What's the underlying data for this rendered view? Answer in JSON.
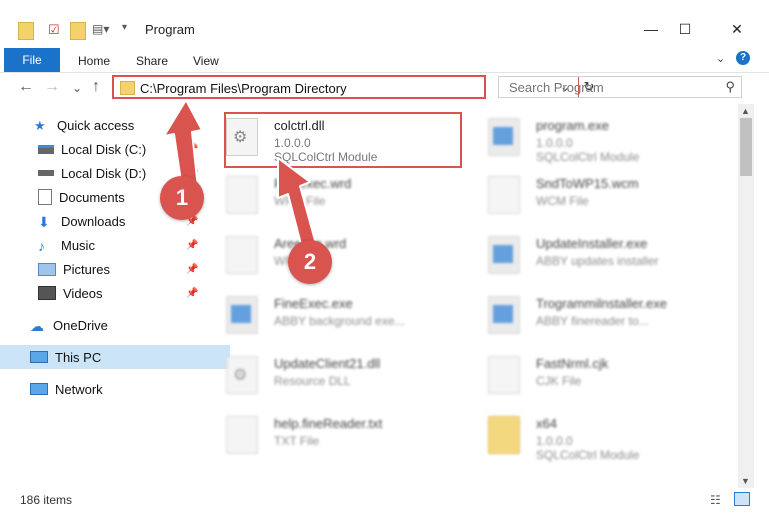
{
  "window": {
    "title": "Program",
    "minimize_glyph": "—",
    "maximize_glyph": "☐",
    "close_glyph": "✕"
  },
  "ribbon": {
    "tabs": [
      "File",
      "Home",
      "Share",
      "View"
    ],
    "help_glyph": "?"
  },
  "navigation": {
    "back_glyph": "←",
    "forward_glyph": "→",
    "recent_glyph": "⌄",
    "up_glyph": "↑",
    "address_path": "C:\\Program Files\\Program Directory",
    "refresh_glyph": "↻"
  },
  "search": {
    "placeholder": "Search Program"
  },
  "sidebar": {
    "items": [
      {
        "label": "Quick access",
        "icon": "star-icon"
      },
      {
        "label": "Local Disk (C:)",
        "icon": "drive-icon"
      },
      {
        "label": "Local Disk (D:)",
        "icon": "drive-icon"
      },
      {
        "label": "Documents",
        "icon": "documents-icon"
      },
      {
        "label": "Downloads",
        "icon": "download-icon"
      },
      {
        "label": "Music",
        "icon": "music-icon"
      },
      {
        "label": "Pictures",
        "icon": "pictures-icon"
      },
      {
        "label": "Videos",
        "icon": "videos-icon"
      },
      {
        "label": "OneDrive",
        "icon": "cloud-icon"
      },
      {
        "label": "This PC",
        "icon": "computer-icon"
      },
      {
        "label": "Network",
        "icon": "network-icon"
      }
    ]
  },
  "files": [
    {
      "name": "colctrl.dll",
      "line1": "1.0.0.0",
      "line2": "SQLColCtrl Module"
    },
    {
      "name": "program.exe",
      "line1": "1.0.0.0",
      "line2": "SQLColCtrl Module"
    },
    {
      "name": "Fineexec.wrd",
      "line1": "WRD File",
      "line2": ""
    },
    {
      "name": "SndToWP15.wcm",
      "line1": "WCM File",
      "line2": ""
    },
    {
      "name": "Areexec.wrd",
      "line1": "WRD File",
      "line2": ""
    },
    {
      "name": "UpdateInstaller.exe",
      "line1": "ABBY updates installer",
      "line2": ""
    },
    {
      "name": "FineExec.exe",
      "line1": "ABBY background exe...",
      "line2": ""
    },
    {
      "name": "Trogrammilnstaller.exe",
      "line1": "ABBY finereader to...",
      "line2": ""
    },
    {
      "name": "UpdateClient21.dll",
      "line1": "Resource DLL",
      "line2": ""
    },
    {
      "name": "FastNrml.cjk",
      "line1": "CJK File",
      "line2": ""
    },
    {
      "name": "help.fineReader.txt",
      "line1": "TXT File",
      "line2": ""
    },
    {
      "name": "x64",
      "line1": "1.0.0.0",
      "line2": "SQLColCtrl Module"
    }
  ],
  "annotations": {
    "badge1": "1",
    "badge2": "2",
    "accent": "#d9534f"
  },
  "status": {
    "item_count": "186 items"
  }
}
